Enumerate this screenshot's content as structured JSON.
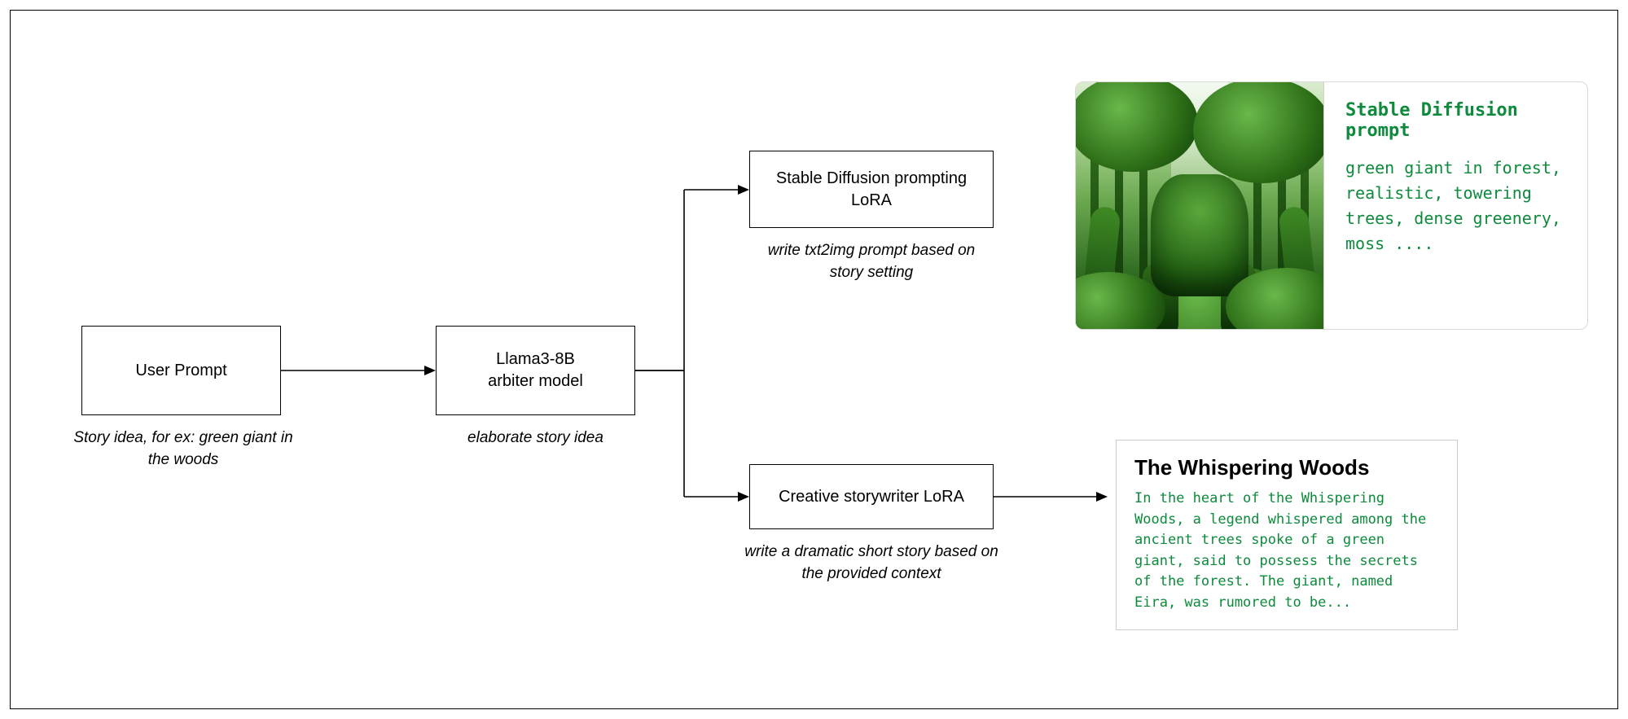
{
  "nodes": {
    "user_prompt": {
      "label": "User Prompt",
      "caption": "Story idea, for ex:\ngreen giant in the woods"
    },
    "arbiter": {
      "label": "Llama3-8B\narbiter model",
      "caption": "elaborate story idea"
    },
    "sd_lora": {
      "label": "Stable Diffusion prompting\nLoRA",
      "caption": "write txt2img prompt\nbased on story setting"
    },
    "story_lora": {
      "label": "Creative storywriter LoRA",
      "caption": "write a dramatic short story\nbased on the provided context"
    }
  },
  "outputs": {
    "sd": {
      "title": "Stable Diffusion prompt",
      "body": "green giant in forest,\nrealistic, towering\ntrees, dense greenery,\nmoss ...."
    },
    "story": {
      "title": "The Whispering Woods",
      "body": "In the heart of the Whispering\nWoods, a legend whispered among the\nancient trees spoke of a green\ngiant, said to possess the secrets\nof the forest. The giant, named\nEira, was rumored to be..."
    }
  }
}
